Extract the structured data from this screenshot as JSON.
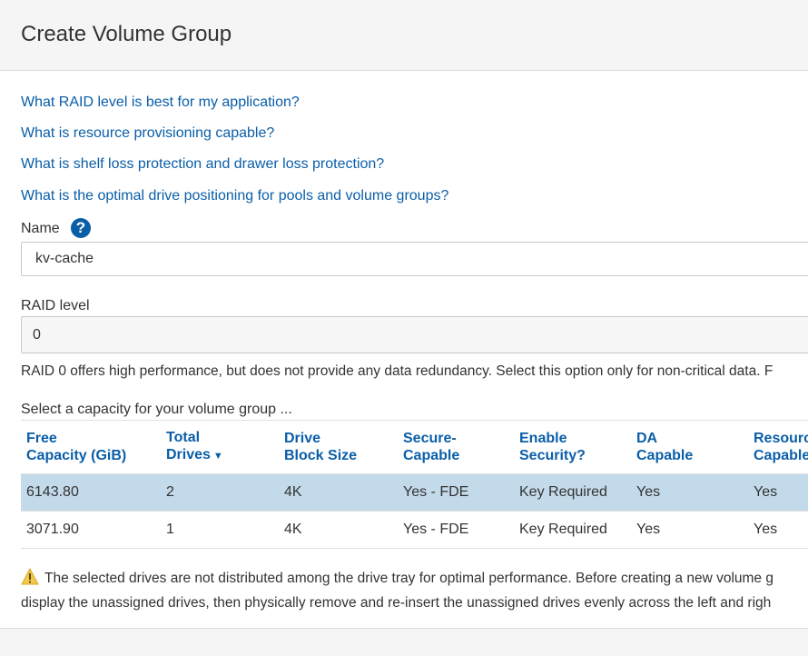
{
  "dialog": {
    "title": "Create Volume Group"
  },
  "help_links": [
    "What RAID level is best for my application?",
    "What is resource provisioning capable?",
    "What is shelf loss protection and drawer loss protection?",
    "What is the optimal drive positioning for pools and volume groups?"
  ],
  "name_field": {
    "label": "Name",
    "value": "kv-cache",
    "help_icon": "question-circle-icon"
  },
  "raid_field": {
    "label": "RAID level",
    "value": "0",
    "description": "RAID 0 offers high performance, but does not provide any data redundancy. Select this option only for non-critical data. F"
  },
  "capacity_table": {
    "label": "Select a capacity for your volume group ...",
    "headers": [
      [
        "Free",
        "Capacity (GiB)"
      ],
      [
        "Total",
        "Drives"
      ],
      [
        "Drive",
        "Block Size"
      ],
      [
        "Secure-",
        "Capable"
      ],
      [
        "Enable",
        "Security?"
      ],
      [
        "DA",
        "Capable"
      ],
      [
        "Resourc",
        "Capable"
      ]
    ],
    "rows": [
      [
        "6143.80",
        "2",
        "4K",
        "Yes - FDE",
        "Key Required",
        "Yes",
        "Yes"
      ],
      [
        "3071.90",
        "1",
        "4K",
        "Yes - FDE",
        "Key Required",
        "Yes",
        "Yes"
      ]
    ],
    "selected_row": 0,
    "sort_column": "Total Drives",
    "sort_direction": "descending"
  },
  "warning": {
    "icon": "warning-triangle-icon",
    "line1": "The selected drives are not distributed among the drive tray for optimal performance. Before creating a new volume g",
    "line2": "display the unassigned drives, then physically remove and re-insert the unassigned drives evenly across the left and righ"
  },
  "colors": {
    "link": "#0a5ea8",
    "selected_row": "#c3daea",
    "header_bg": "#f5f5f5",
    "warning": "#f2c94c"
  }
}
